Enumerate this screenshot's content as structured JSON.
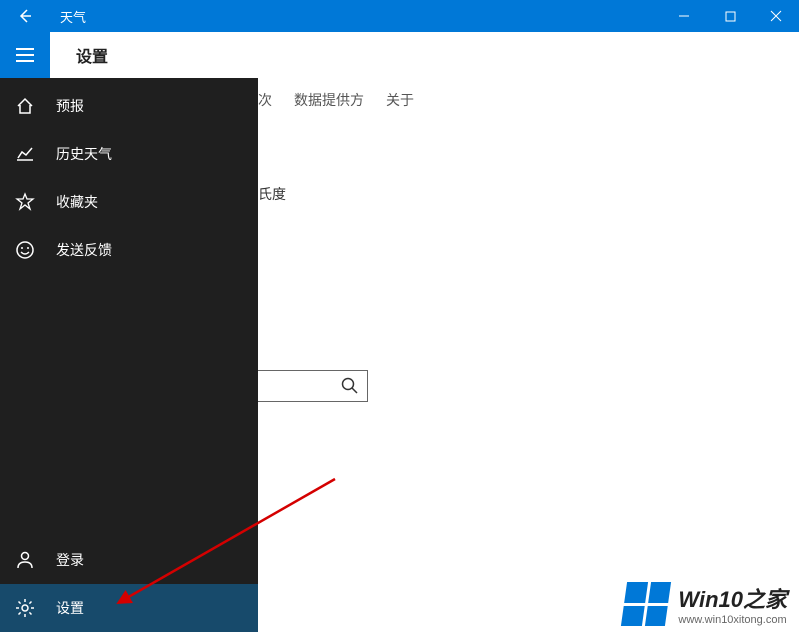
{
  "titlebar": {
    "app_title": "天气"
  },
  "subheader": {
    "title": "设置"
  },
  "tabs": {
    "t0_partial": "次",
    "t1": "数据提供方",
    "t2": "关于"
  },
  "content": {
    "unit_label_partial": "氏度"
  },
  "sidebar": {
    "forecast": "预报",
    "history": "历史天气",
    "favorites": "收藏夹",
    "feedback": "发送反馈",
    "signin": "登录",
    "settings": "设置"
  },
  "watermark": {
    "line1": "Win10之家",
    "line2": "www.win10xitong.com"
  }
}
